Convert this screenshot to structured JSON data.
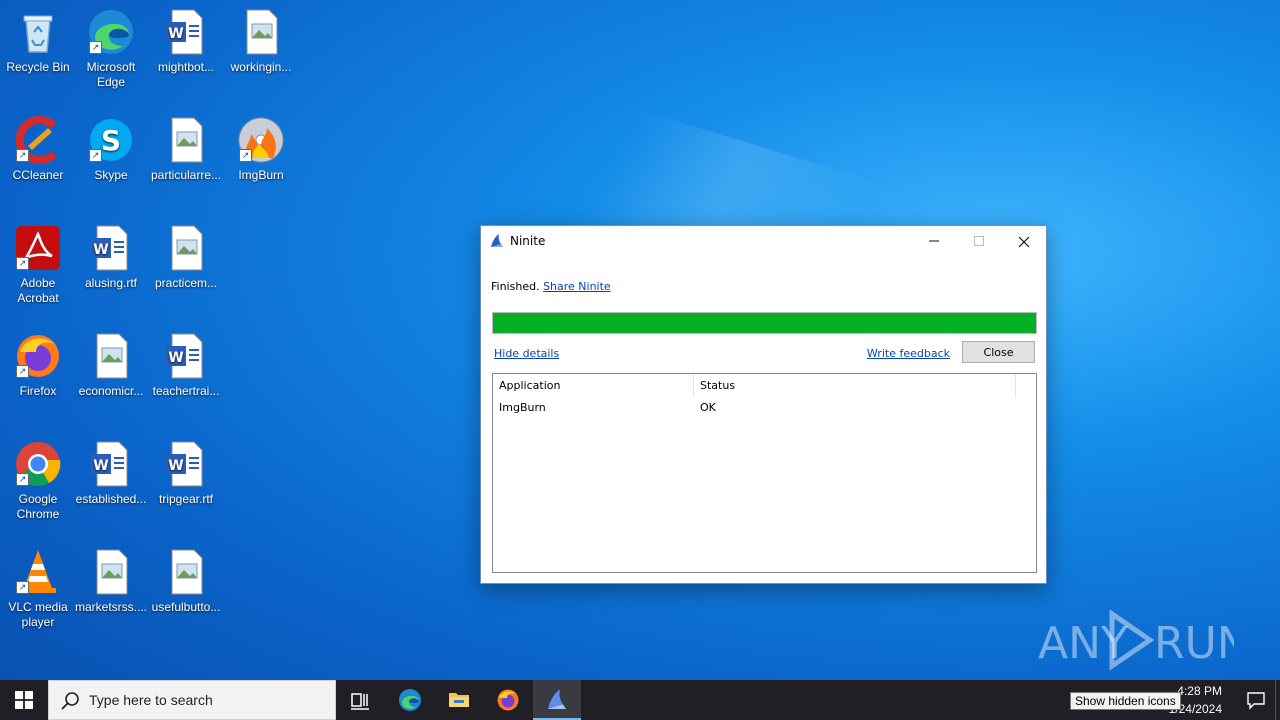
{
  "desktop": {
    "icons": [
      {
        "label": "Recycle Bin"
      },
      {
        "label": "Microsoft Edge"
      },
      {
        "label": "mightbot..."
      },
      {
        "label": "workingin..."
      },
      {
        "label": "CCleaner"
      },
      {
        "label": "Skype"
      },
      {
        "label": "particularre..."
      },
      {
        "label": "ImgBurn"
      },
      {
        "label": "Adobe Acrobat"
      },
      {
        "label": "alusing.rtf"
      },
      {
        "label": "practicem..."
      },
      {
        "label": "Firefox"
      },
      {
        "label": "economicr..."
      },
      {
        "label": "teachertrai..."
      },
      {
        "label": "Google Chrome"
      },
      {
        "label": "established..."
      },
      {
        "label": "tripgear.rtf"
      },
      {
        "label": "VLC media player"
      },
      {
        "label": "marketsrss...."
      },
      {
        "label": "usefulbutto..."
      }
    ]
  },
  "window": {
    "title": "Ninite",
    "status": "Finished.",
    "share_link": "Share Ninite",
    "progress_percent": 100,
    "progress_color": "#06b025",
    "hide_details": "Hide details",
    "write_feedback": "Write feedback",
    "close_button": "Close",
    "columns": [
      "Application",
      "Status"
    ],
    "rows": [
      {
        "application": "ImgBurn",
        "status": "OK"
      }
    ]
  },
  "watermark": {
    "text": "ANY RUN"
  },
  "taskbar": {
    "search_placeholder": "Type here to search",
    "time": "4:28 PM",
    "date": "1/24/2024",
    "tooltip": "Show hidden icons"
  }
}
